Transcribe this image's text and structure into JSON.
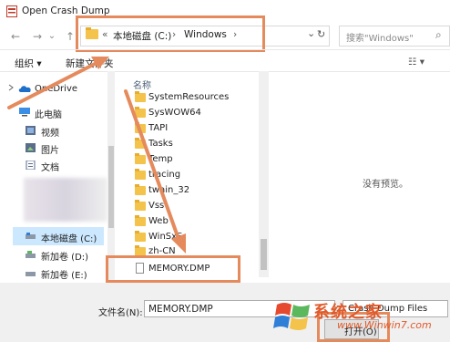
{
  "window": {
    "title": "Open Crash Dump"
  },
  "nav": {
    "back": "←",
    "forward": "→",
    "dropdown": "⌄",
    "up": "↑"
  },
  "address": {
    "overflow": "«",
    "parts": [
      "本地磁盘 (C:)",
      "›",
      "Windows",
      "›"
    ],
    "dropdown": "⌄",
    "refresh": "↻"
  },
  "search": {
    "placeholder": "搜索\"Windows\"",
    "icon": "⌕"
  },
  "toolbar": {
    "organize": "组织 ▾",
    "new_folder": "新建文件夹",
    "view": "☷ ▾"
  },
  "sidebar": {
    "onedrive": "OneDrive",
    "items": [
      {
        "label": "此电脑",
        "icon": "computer-icon"
      },
      {
        "label": "视频",
        "icon": "video-folder-icon"
      },
      {
        "label": "图片",
        "icon": "picture-folder-icon"
      },
      {
        "label": "文档",
        "icon": "document-folder-icon"
      },
      {
        "label": "本地磁盘 (C:)",
        "icon": "drive-icon"
      },
      {
        "label": "新加卷 (D:)",
        "icon": "drive-icon"
      },
      {
        "label": "新加卷 (E:)",
        "icon": "drive-icon"
      }
    ]
  },
  "filelist": {
    "column_header": "名称",
    "folders": [
      "SystemResources",
      "SysWOW64",
      "TAPI",
      "Tasks",
      "Temp",
      "tracing",
      "twain_32",
      "Vss",
      "Web",
      "WinSxS",
      "zh-CN"
    ],
    "files": [
      "MEMORY.DMP"
    ]
  },
  "preview": {
    "empty_text": "没有预览。"
  },
  "bottom": {
    "filename_label": "文件名(N):",
    "filename_value": "MEMORY.DMP",
    "filter_value": "Crash Dump Files",
    "open_button": "打开(O)"
  },
  "watermark": {
    "text": "系统之家",
    "url": "www.Winwin7.com"
  },
  "colors": {
    "highlight": "#e58a5c",
    "selection": "#cce8ff",
    "folder": "#f3c34b"
  }
}
